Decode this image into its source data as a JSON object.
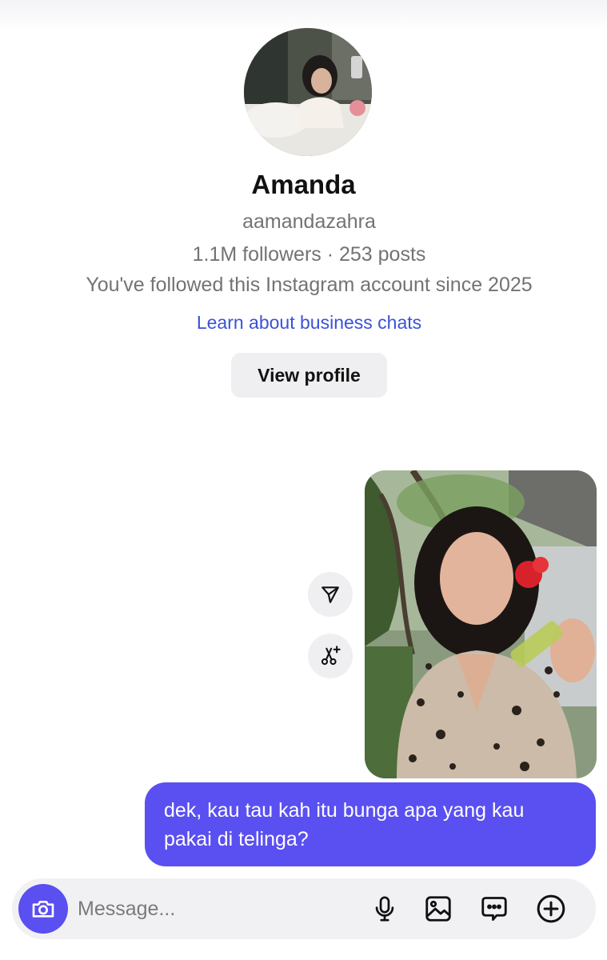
{
  "profile": {
    "name": "Amanda",
    "username": "aamandazahra",
    "stats": "1.1M followers · 253 posts",
    "follow_since": "You've followed this Instagram account since 2025",
    "learn_link": "Learn about business chats",
    "view_profile_label": "View profile"
  },
  "conversation": {
    "sent_message": "dek, kau tau kah itu bunga apa yang kau pakai di telinga?"
  },
  "composer": {
    "placeholder": "Message..."
  },
  "icons": {
    "share": "paper-plane-icon",
    "ai_edit": "scissors-sparkle-icon",
    "camera": "camera-icon",
    "mic": "microphone-icon",
    "gallery": "image-icon",
    "sticker": "chat-bubble-icon",
    "add": "plus-circle-icon"
  },
  "colors": {
    "accent": "#5a4ff0",
    "link": "#3b52d6",
    "secondary_text": "#737373"
  }
}
